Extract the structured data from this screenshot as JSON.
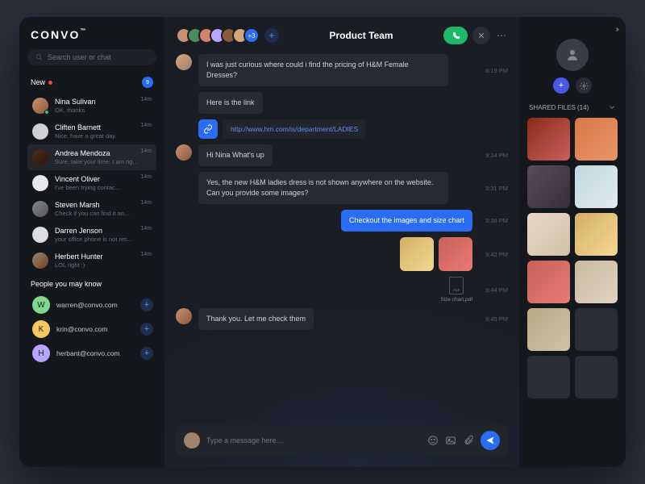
{
  "brand": "CONVO",
  "brand_tm": "™",
  "search": {
    "placeholder": "Search user or chat"
  },
  "newLabel": "New",
  "newCount": "9",
  "contacts": [
    {
      "name": "Nina Sulivan",
      "preview": "OK, thanks",
      "time": "14m"
    },
    {
      "name": "Cliften Barnett",
      "preview": "Nice, have a great day.",
      "time": "14m"
    },
    {
      "name": "Andrea Mendoza",
      "preview": "Sure, take your time. I am rig…",
      "time": "14m"
    },
    {
      "name": "Vincent Oliver",
      "preview": "I've been trying contac…",
      "time": "14m"
    },
    {
      "name": "Steven Marsh",
      "preview": "Check if you can find it an…",
      "time": "14m"
    },
    {
      "name": "Darren Jenson",
      "preview": "your office phone is not res…",
      "time": "14m"
    },
    {
      "name": "Herbert Hunter",
      "preview": "LOL right :)",
      "time": "14m"
    }
  ],
  "peopleTitle": "People you may know",
  "suggestions": [
    {
      "initial": "W",
      "email": "warren@convo.com"
    },
    {
      "initial": "K",
      "email": "krin@convo.com"
    },
    {
      "initial": "H",
      "email": "herbant@convo.com"
    }
  ],
  "chat": {
    "title": "Product Team",
    "extraCount": "+3",
    "messages": [
      {
        "text": "I was just curious where could i find the pricing of H&M Female Dresses?",
        "time": "8:19 PM"
      },
      {
        "text": "Here is the link",
        "time": ""
      },
      {
        "link": "http://www.hm.com/is/department/LADIES",
        "time": ""
      },
      {
        "text": "Hi Nina What's up",
        "time": "9:24 PM"
      },
      {
        "text": "Yes, the new H&M ladies dress is not shown anywhere on the website. Can you provide some images?",
        "time": "9:31 PM"
      },
      {
        "me": true,
        "text": "Checkout the images and size chart",
        "time": "9:38 PM"
      },
      {
        "me": true,
        "images": true,
        "time": "9:42 PM"
      },
      {
        "me": true,
        "file": "Size chart.pdf",
        "time": "9:44 PM"
      },
      {
        "text": "Thank you. Let me check them",
        "time": "9:45 PM"
      }
    ],
    "composerPlaceholder": "Type a message here…"
  },
  "panel": {
    "filesTitle": "SHARED FILES (14)"
  }
}
